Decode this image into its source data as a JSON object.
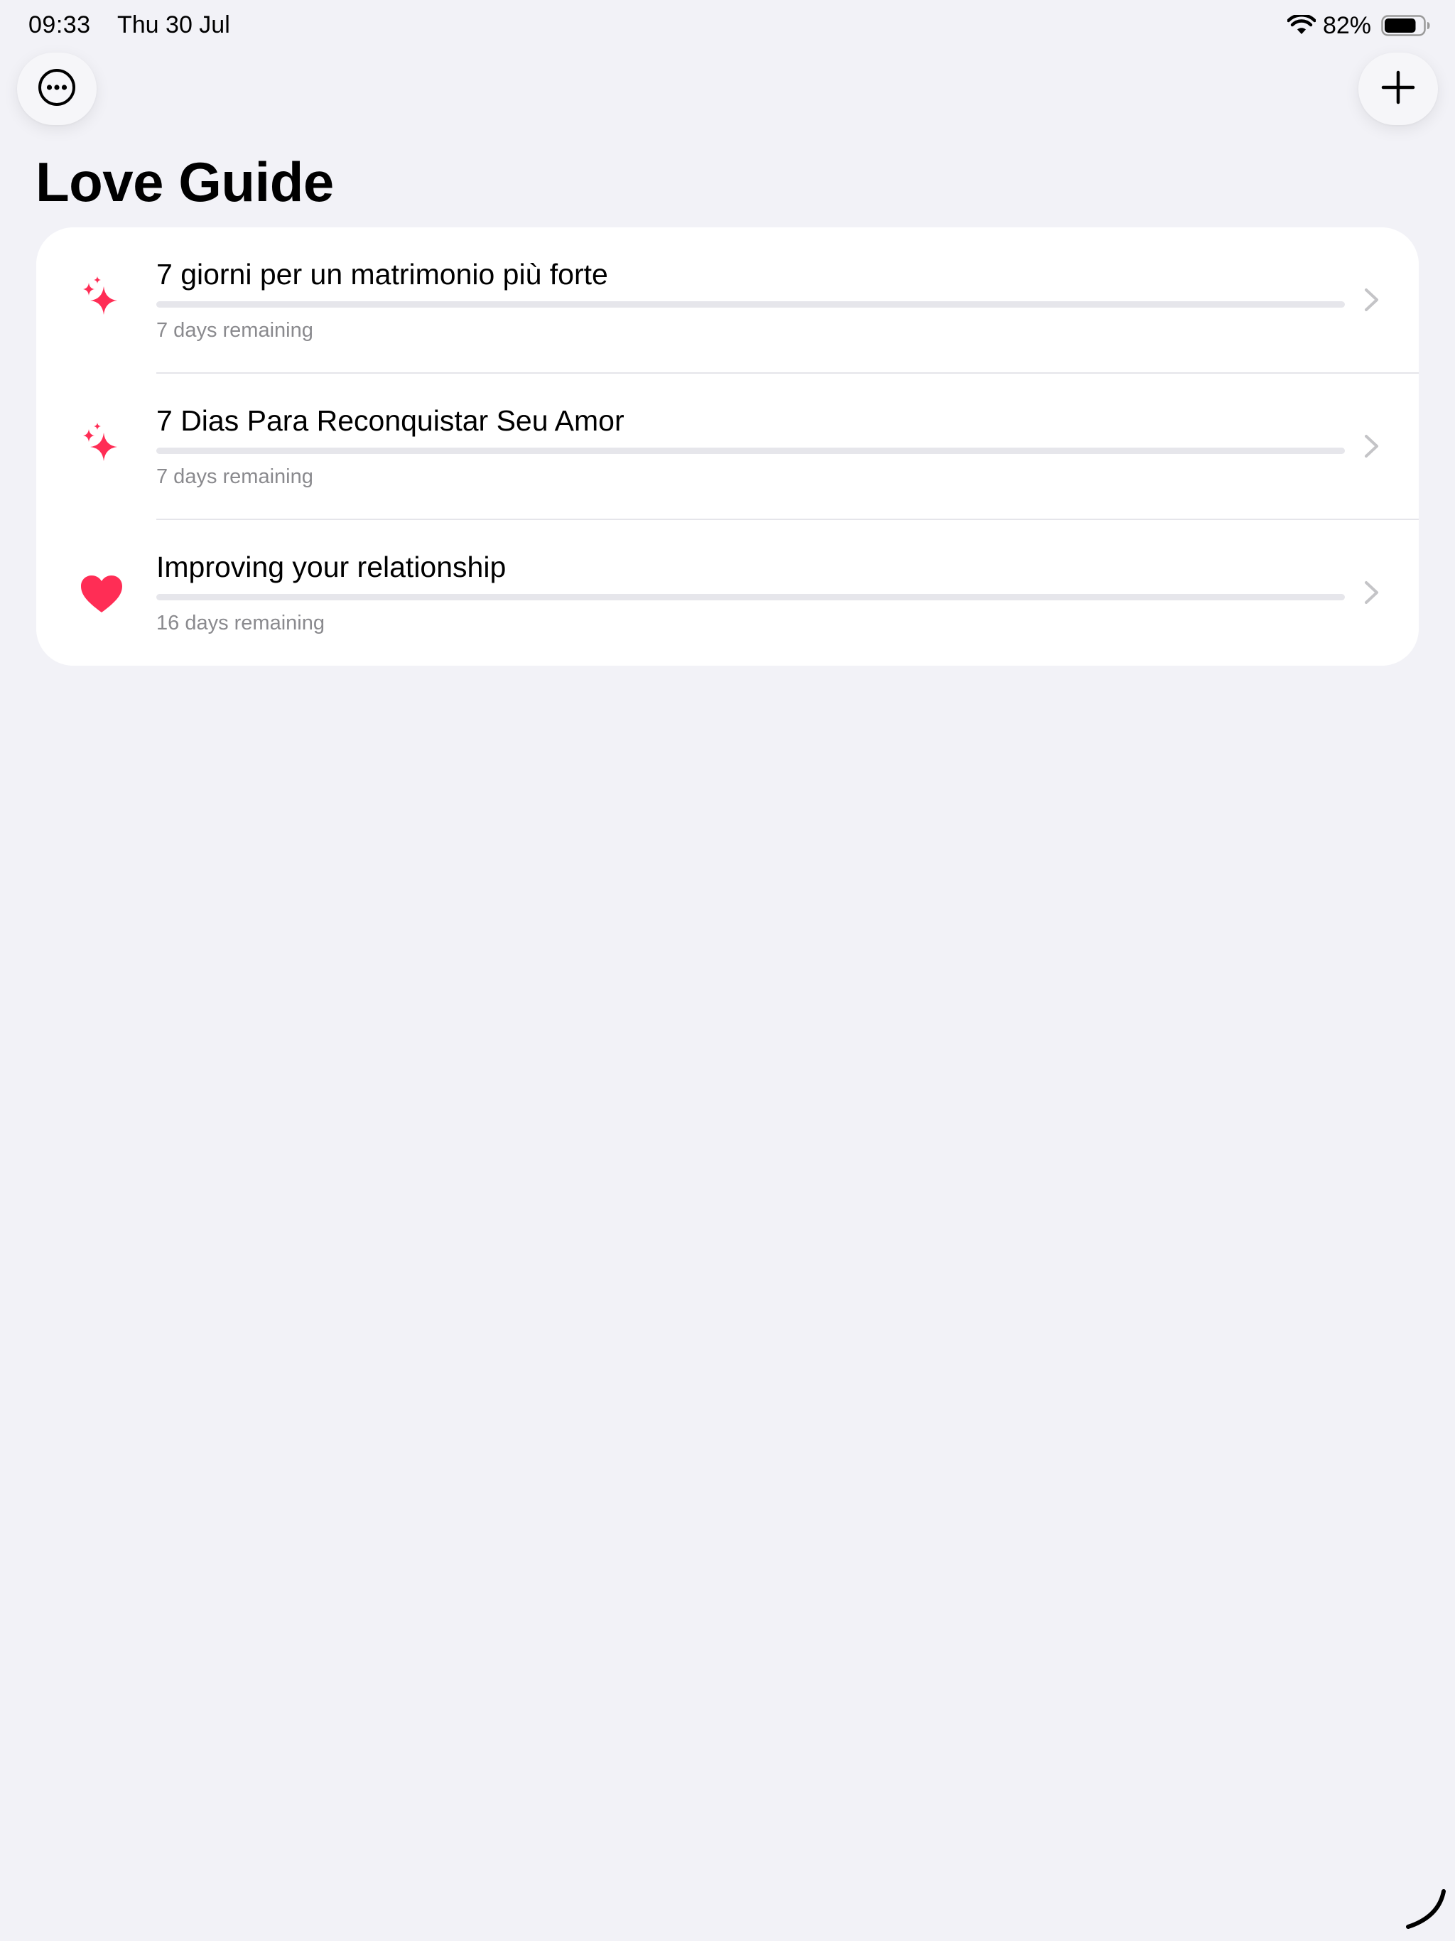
{
  "status_bar": {
    "time": "09:33",
    "date": "Thu 30 Jul",
    "battery_percent": "82%",
    "battery_level": 0.82
  },
  "toolbar": {
    "more_icon": "ellipsis-circle-icon",
    "add_icon": "plus-icon"
  },
  "page": {
    "title": "Love Guide"
  },
  "guides": [
    {
      "title": "7 giorni per un matrimonio più forte",
      "remaining": "7 days remaining",
      "icon": "sparkles-icon",
      "progress": 0
    },
    {
      "title": "7 Dias Para Reconquistar Seu Amor",
      "remaining": "7 days remaining",
      "icon": "sparkles-icon",
      "progress": 0
    },
    {
      "title": "Improving your relationship",
      "remaining": "16 days remaining",
      "icon": "heart-icon",
      "progress": 0
    }
  ],
  "colors": {
    "accent": "#FF2D55",
    "background": "#F2F2F7",
    "card": "#FFFFFF",
    "secondary_text": "#8A8A8E",
    "progress_track": "#E6E6EB"
  }
}
